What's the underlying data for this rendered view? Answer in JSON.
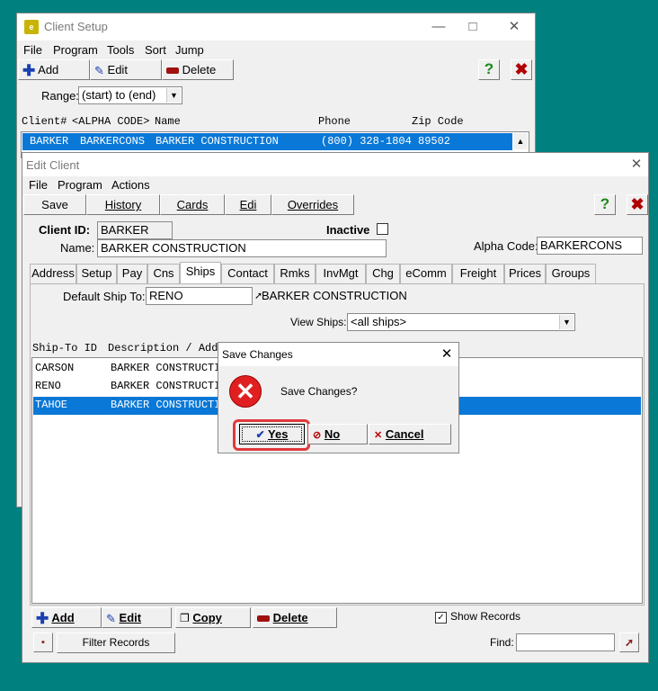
{
  "client_setup": {
    "title": "Client Setup",
    "menu": [
      "File",
      "Program",
      "Tools",
      "Sort",
      "Jump"
    ],
    "toolbar": {
      "add": "Add",
      "edit": "Edit",
      "delete": "Delete"
    },
    "range_label": "Range:",
    "range_value": "(start) to (end)",
    "columns": {
      "client": "Client#",
      "alpha": "<ALPHA CODE>",
      "name": "Name",
      "phone": "Phone",
      "zip": "Zip Code"
    },
    "rows": [
      {
        "client": "BARKER",
        "alpha": "BARKERCONS",
        "name": "BARKER CONSTRUCTION",
        "phone": "(800) 328-1804",
        "zip": "89502"
      }
    ]
  },
  "edit_client": {
    "title": "Edit Client",
    "menu": [
      "File",
      "Program",
      "Actions"
    ],
    "toolbar": {
      "save": "Save",
      "history": "History",
      "cards": "Cards",
      "edi": "Edi",
      "overrides": "Overrides"
    },
    "client_id_label": "Client ID:",
    "client_id": "BARKER",
    "name_label": "Name:",
    "name": "BARKER CONSTRUCTION",
    "inactive_label": "Inactive",
    "alpha_label": "Alpha Code:",
    "alpha_code": "BARKERCONS",
    "tabs": [
      "Address",
      "Setup",
      "Pay",
      "Cns",
      "Ships",
      "Contact",
      "Rmks",
      "InvMgt",
      "Chg",
      "eComm",
      "Freight",
      "Prices",
      "Groups"
    ],
    "active_tab": "Ships",
    "default_ship_label": "Default Ship To:",
    "default_ship": "RENO",
    "default_ship_desc": "BARKER CONSTRUCTION",
    "view_ships_label": "View Ships:",
    "view_ships": "<all ships>",
    "ship_columns": {
      "id": "Ship-To ID",
      "desc": "Description / Addr"
    },
    "ships": [
      {
        "id": "CARSON",
        "desc": "BARKER CONSTRUCTIO"
      },
      {
        "id": "RENO",
        "desc": "BARKER CONSTRUCTIO"
      },
      {
        "id": "TAHOE",
        "desc": "BARKER CONSTRUCTIO"
      }
    ],
    "bottom": {
      "add": "Add",
      "edit": "Edit",
      "copy": "Copy",
      "delete": "Delete",
      "show_records": "Show Records",
      "filter": "Filter Records",
      "find_label": "Find:"
    }
  },
  "dialog": {
    "title": "Save Changes",
    "message": "Save Changes?",
    "yes": "Yes",
    "no": "No",
    "cancel": "Cancel"
  },
  "colors": {
    "desktop": "#00807f",
    "selection": "#0a78d7",
    "highlight": "#e0393e"
  }
}
